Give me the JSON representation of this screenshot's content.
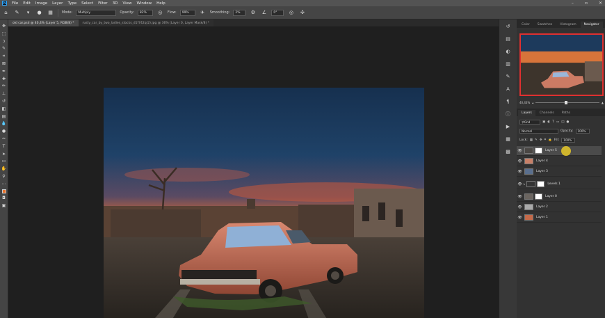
{
  "menu": {
    "items": [
      "File",
      "Edit",
      "Image",
      "Layer",
      "Type",
      "Select",
      "Filter",
      "3D",
      "View",
      "Window",
      "Help"
    ],
    "logo": "Ps"
  },
  "options": {
    "mode_label": "Mode:",
    "mode_value": "Multiply",
    "opacity_label": "Opacity:",
    "opacity_value": "82%",
    "flow_label": "Flow:",
    "flow_value": "99%",
    "smoothing_label": "Smoothing:",
    "smoothing_value": "2%",
    "angle_value": "0°"
  },
  "tabs": [
    {
      "label": "old car.psd @ 40,4% (Layer 5, RGB/8) *"
    },
    {
      "label": "rusty_car_by_two_ladies_stocks_d1f742q(2).jpg @ 36% (Layer 0, Layer Mask/8) *"
    }
  ],
  "navigator": {
    "tabs": [
      "Color",
      "Swatches",
      "Histogram",
      "Navigator"
    ],
    "zoom": "40,43%"
  },
  "layers": {
    "tabs": [
      "Layers",
      "Channels",
      "Paths"
    ],
    "filter_kind": "Kind",
    "blend_mode": "Normal",
    "opacity_label": "Opacity:",
    "opacity_value": "100%",
    "lock_label": "Lock:",
    "fill_label": "Fill:",
    "fill_value": "100%",
    "items": [
      {
        "name": "Layer 5",
        "has_mask": true,
        "active": true
      },
      {
        "name": "Layer 4",
        "has_mask": false,
        "active": false
      },
      {
        "name": "Layer 3",
        "has_mask": false,
        "active": false
      },
      {
        "name": "Levels 1",
        "has_mask": true,
        "active": false
      },
      {
        "name": "Layer 0",
        "has_mask": true,
        "active": false
      },
      {
        "name": "Layer 2",
        "has_mask": false,
        "active": false
      },
      {
        "name": "Layer 1",
        "has_mask": false,
        "active": false
      }
    ]
  },
  "colors": {
    "foreground": "#e8732d",
    "selection": "#e03030",
    "accent": "#2fa3f7"
  }
}
